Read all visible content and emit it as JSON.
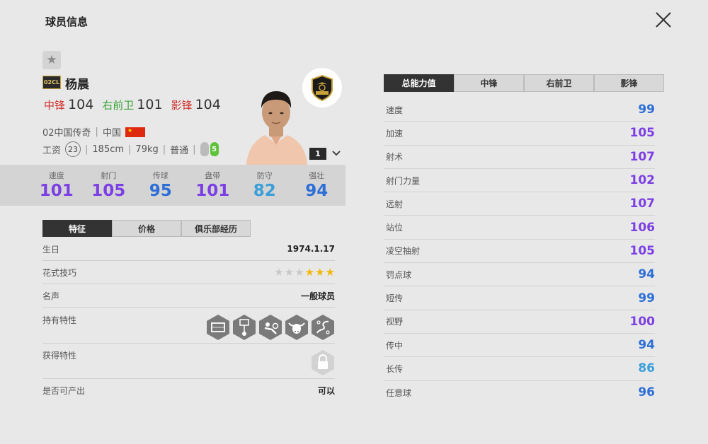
{
  "header": {
    "title": "球员信息"
  },
  "player": {
    "season_badge": "02CL",
    "name": "杨晨",
    "positions": [
      {
        "name": "中锋",
        "value": "104",
        "color": "#d0312d"
      },
      {
        "name": "右前卫",
        "value": "101",
        "color": "#3aa33a"
      },
      {
        "name": "影锋",
        "value": "104",
        "color": "#d0312d"
      }
    ],
    "team": "02中国传奇",
    "nation": "中国",
    "wage_label": "工资",
    "wage": "23",
    "height": "185cm",
    "weight": "79kg",
    "body_type": "普通",
    "weak_foot": "5",
    "level": "1"
  },
  "main_stats": [
    {
      "label": "速度",
      "value": "101",
      "color": "#7b3fe4"
    },
    {
      "label": "射门",
      "value": "105",
      "color": "#7b3fe4"
    },
    {
      "label": "传球",
      "value": "95",
      "color": "#2d6fd6"
    },
    {
      "label": "盘带",
      "value": "101",
      "color": "#7b3fe4"
    },
    {
      "label": "防守",
      "value": "82",
      "color": "#3a9fd8"
    },
    {
      "label": "强壮",
      "value": "94",
      "color": "#2d6fd6"
    }
  ],
  "left_tabs": [
    "特征",
    "价格",
    "俱乐部经历"
  ],
  "details": {
    "birthday_label": "生日",
    "birthday": "1974.1.17",
    "skill_label": "花式技巧",
    "skill_stars": 3,
    "skill_max": 6,
    "reputation_label": "名声",
    "reputation": "一般球员",
    "traits_label": "持有特性",
    "acquired_label": "获得特性",
    "producible_label": "是否可产出",
    "producible": "可以"
  },
  "right_tabs": [
    "总能力值",
    "中锋",
    "右前卫",
    "影锋"
  ],
  "attributes": [
    {
      "name": "速度",
      "value": "99",
      "color": "#2d6fd6"
    },
    {
      "name": "加速",
      "value": "105",
      "color": "#7b3fe4"
    },
    {
      "name": "射术",
      "value": "107",
      "color": "#7b3fe4"
    },
    {
      "name": "射门力量",
      "value": "102",
      "color": "#7b3fe4"
    },
    {
      "name": "远射",
      "value": "107",
      "color": "#7b3fe4"
    },
    {
      "name": "站位",
      "value": "106",
      "color": "#7b3fe4"
    },
    {
      "name": "凌空抽射",
      "value": "105",
      "color": "#7b3fe4"
    },
    {
      "name": "罚点球",
      "value": "94",
      "color": "#2d6fd6"
    },
    {
      "name": "短传",
      "value": "99",
      "color": "#2d6fd6"
    },
    {
      "name": "视野",
      "value": "100",
      "color": "#7b3fe4"
    },
    {
      "name": "传中",
      "value": "94",
      "color": "#2d6fd6"
    },
    {
      "name": "长传",
      "value": "86",
      "color": "#3a9fd8"
    },
    {
      "name": "任意球",
      "value": "96",
      "color": "#2d6fd6"
    }
  ],
  "colors": {
    "dark_tab": "#333333",
    "background": "#e8e8e8"
  }
}
